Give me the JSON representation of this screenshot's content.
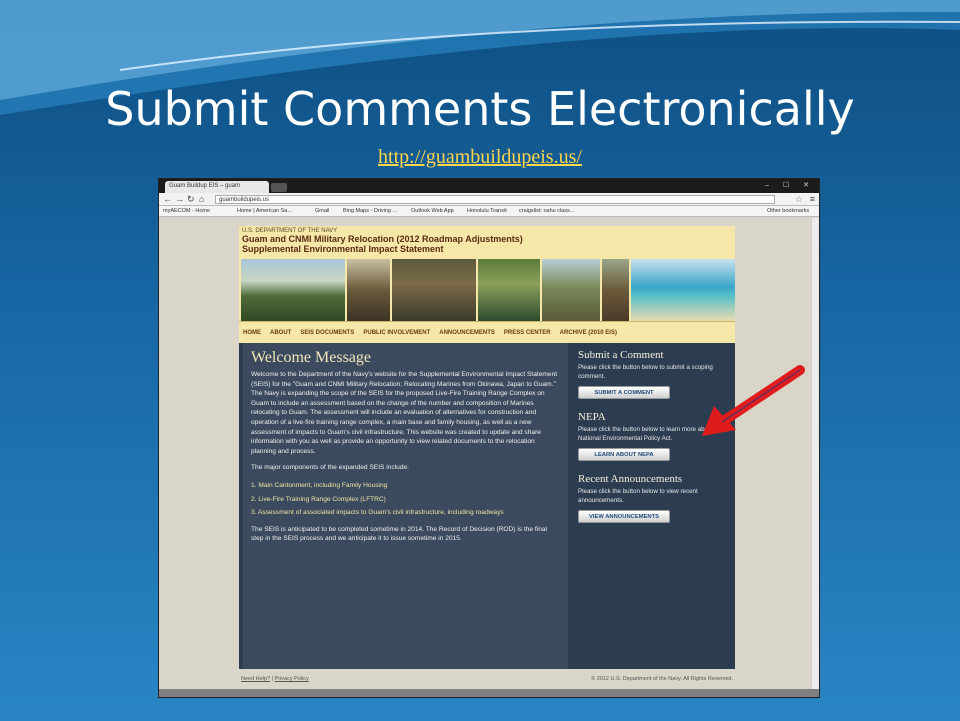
{
  "slide": {
    "title": "Submit Comments Electronically",
    "link": "http://guambuildupeis.us/"
  },
  "browser": {
    "tab_title": "Guam Buildup EIS – guam",
    "window_controls": "– ☐ ✕",
    "url": "guambuildupeis.us",
    "bookmarks": [
      "myAECOM - Home",
      "Home | American Sa...",
      "Gmail",
      "Bing Maps - Driving ...",
      "Outlook Web App",
      "Honolulu Transit",
      "craigslist: oahu class...",
      "Other bookmarks"
    ]
  },
  "site": {
    "dept": "U.S. DEPARTMENT OF THE NAVY",
    "header_line1": "Guam and CNMI Military Relocation (2012 Roadmap Adjustments)",
    "header_line2": "Supplemental Environmental Impact Statement",
    "nav": [
      "HOME",
      "ABOUT",
      "SEIS DOCUMENTS",
      "PUBLIC INVOLVEMENT",
      "ANNOUNCEMENTS",
      "PRESS CENTER",
      "ARCHIVE (2010 EIS)"
    ],
    "welcome_title": "Welcome Message",
    "welcome_para": "Welcome to the Department of the Navy's website for the Supplemental Environmental Impact Statement (SEIS) for the \"Guam and CNMI Military Relocation; Relocating Marines from Okinawa, Japan to Guam.\" The Navy is expanding the scope of the SEIS for the proposed Live-Fire Training Range Complex on Guam to include an assessment based on the change of the number and composition of Marines relocating to Guam. The assessment will include an evaluation of alternatives for construction and operation of a live-fire training range complex, a main base and family housing, as well as a new assessment of impacts to Guam's civil infrastructure. This website was created to update and share information with you as well as provide an opportunity to view related documents to the relocation planning and process.",
    "components_intro": "The major components of the expanded SEIS include:",
    "components": [
      "1.  Main Cantonment, including Family Housing",
      "2.  Live-Fire Training Range Complex (LFTRC)",
      "3.  Assessment of associated impacts to Guam's civil infrastructure, including roadways"
    ],
    "closing_para": "The SEIS is anticipated to be completed sometime in 2014. The Record of Decision (ROD) is the final step in the SEIS process and we anticipate it to issue sometime in 2015.",
    "sidebar": {
      "comment_title": "Submit a Comment",
      "comment_text": "Please click the button below to submit a scoping comment.",
      "comment_button": "SUBMIT A COMMENT",
      "nepa_title": "NEPA",
      "nepa_text": "Please click the button below to learn more about the National Environmental Policy Act.",
      "nepa_button": "LEARN ABOUT NEPA",
      "ann_title": "Recent Announcements",
      "ann_text": "Please click the button below to view recent announcements.",
      "ann_button": "VIEW ANNOUNCEMENTS"
    },
    "footer_help": "Need Help?",
    "footer_privacy": "Privacy Policy",
    "footer_copyright": "© 2012 U.S. Department of the Navy. All Rights Reserved."
  },
  "colors": {
    "slide_bg": "#1868a6",
    "link": "#ffd54a",
    "arrow": "#e01b1b",
    "header_bg": "#f4e7a8",
    "content_bg": "#3b4a5e"
  }
}
